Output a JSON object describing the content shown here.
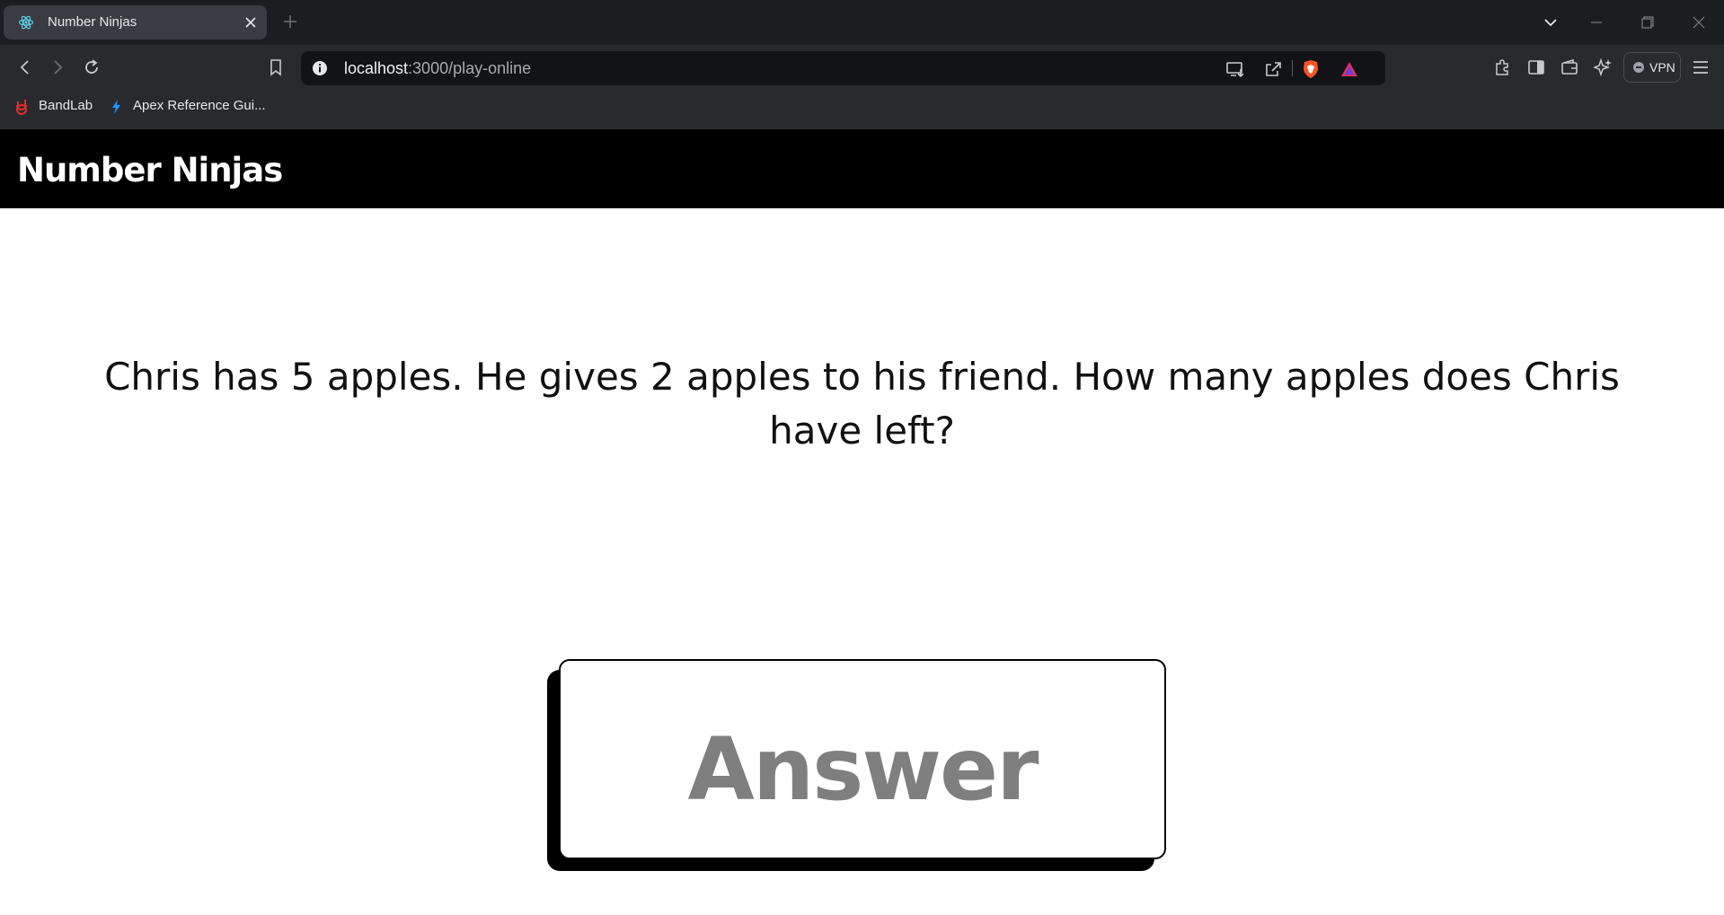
{
  "browser": {
    "tab": {
      "title": "Number Ninjas"
    },
    "url": {
      "host": "localhost",
      "path": ":3000/play-online"
    },
    "vpn_label": "VPN",
    "bookmarks": [
      {
        "label": "BandLab",
        "icon": "bandlab-icon"
      },
      {
        "label": "Apex Reference Gui...",
        "icon": "lightning-icon"
      }
    ]
  },
  "page": {
    "brand": "Number Ninjas",
    "question": "Chris has 5 apples. He gives 2 apples to his friend. How many apples does Chris have left?",
    "answer": {
      "value": "",
      "placeholder": "Answer"
    }
  },
  "colors": {
    "header_bg": "#000000",
    "page_bg": "#ffffff",
    "placeholder": "#7f7f7f",
    "chrome_bg": "#1c1d20"
  }
}
